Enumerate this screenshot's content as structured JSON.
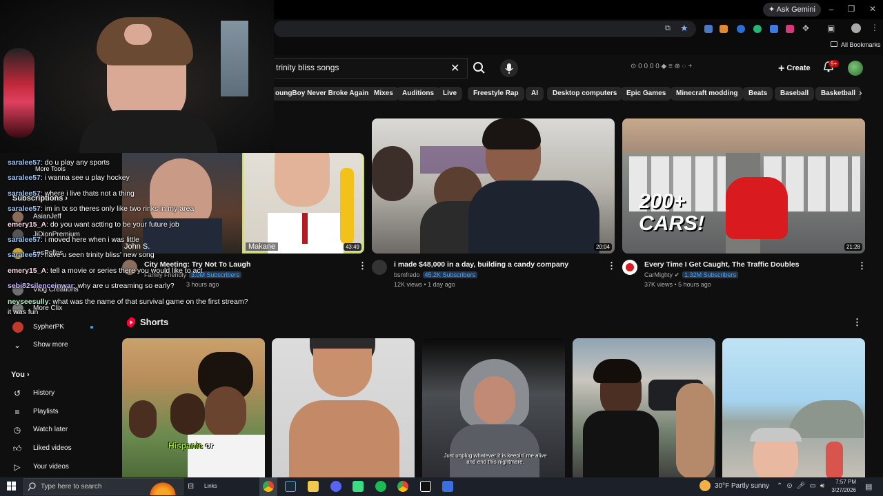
{
  "browser": {
    "gemini_label": "Ask Gemini",
    "all_bookmarks": "All Bookmarks"
  },
  "search": {
    "query": "trinity bliss songs"
  },
  "header": {
    "stats": "0  0  0  0",
    "create_label": "Create",
    "notif_count": "9+"
  },
  "chips": [
    "oungBoy Never Broke Again",
    "Mixes",
    "Auditions",
    "Live",
    "Freestyle Rap",
    "AI",
    "Desktop computers",
    "Epic Games",
    "Minecraft modding",
    "Beats",
    "Baseball",
    "Basketball"
  ],
  "sidebar": {
    "subscriptions_label": "Subscriptions",
    "more_tools": "More Tools",
    "items": [
      {
        "label": "AsianJeff"
      },
      {
        "label": "JiDionPremium"
      },
      {
        "label": "LosPollos"
      },
      {
        "label": "Vlog Creations"
      },
      {
        "label": "More Clix"
      },
      {
        "label": "SypherPK"
      },
      {
        "label": "Show more"
      }
    ],
    "you_label": "You",
    "you_items": [
      {
        "label": "History"
      },
      {
        "label": "Playlists"
      },
      {
        "label": "Watch later"
      },
      {
        "label": "Liked videos"
      },
      {
        "label": "Your videos"
      }
    ]
  },
  "chat": [
    {
      "user": "saralee57",
      "msg": ": do u play any sports"
    },
    {
      "user": "saralee57",
      "msg": ": i wanna see u play hockey"
    },
    {
      "user": "saralee57",
      "msg": ": where i live thats not a thing"
    },
    {
      "user": "saralee57",
      "msg": ": im in tx so theres only like two rinks in my area"
    },
    {
      "user": "emery15_A",
      "msg": ": do you want actting to be your future job"
    },
    {
      "user": "saralee57",
      "msg": ": i moved here when i was little"
    },
    {
      "user": "saralee57",
      "msg": ": have u seen trinity bliss' new song"
    },
    {
      "user": "emery15_A",
      "msg": ": tell a movie or series there you would like to act"
    },
    {
      "user": "sebi82silenceinwar",
      "msg": ": why are u streaming so early?"
    },
    {
      "user": "neyseesully",
      "msg": ": what was the name of that survival game on the first stream?"
    },
    {
      "user": "",
      "msg": "it was fun"
    }
  ],
  "videos": [
    {
      "title": "City Meeting: Try Not To Laugh",
      "channel": "Family Friendly",
      "subs": "3.0M Subscribers",
      "meta": "3 hours ago",
      "duration": "43:49",
      "overlay_left": "John S.",
      "overlay_right": "Makane"
    },
    {
      "title": "i made $48,000 in a day, building a candy company",
      "channel": "bsmfredo",
      "subs": "45.2K Subscribers",
      "meta": "12K views • 1 day ago",
      "duration": "20:04"
    },
    {
      "title": "Every Time I Get Caught, The Traffic Doubles",
      "channel": "CarMighty",
      "subs": "1.32M Subscribers",
      "meta": "37K views • 5 hours ago",
      "duration": "21:28",
      "thumb_text": "200+\nCARS!"
    }
  ],
  "shorts": {
    "label": "Shorts",
    "captions": [
      "Hispanic or",
      "",
      "Just unplug whatever it is keepin' me alive and end this nightmare.",
      "",
      ""
    ]
  },
  "taskbar": {
    "search_placeholder": "Type here to search",
    "links": "Links",
    "weather": "30°F  Partly sunny",
    "time": "7:57 PM",
    "date": "3/27/2026"
  }
}
